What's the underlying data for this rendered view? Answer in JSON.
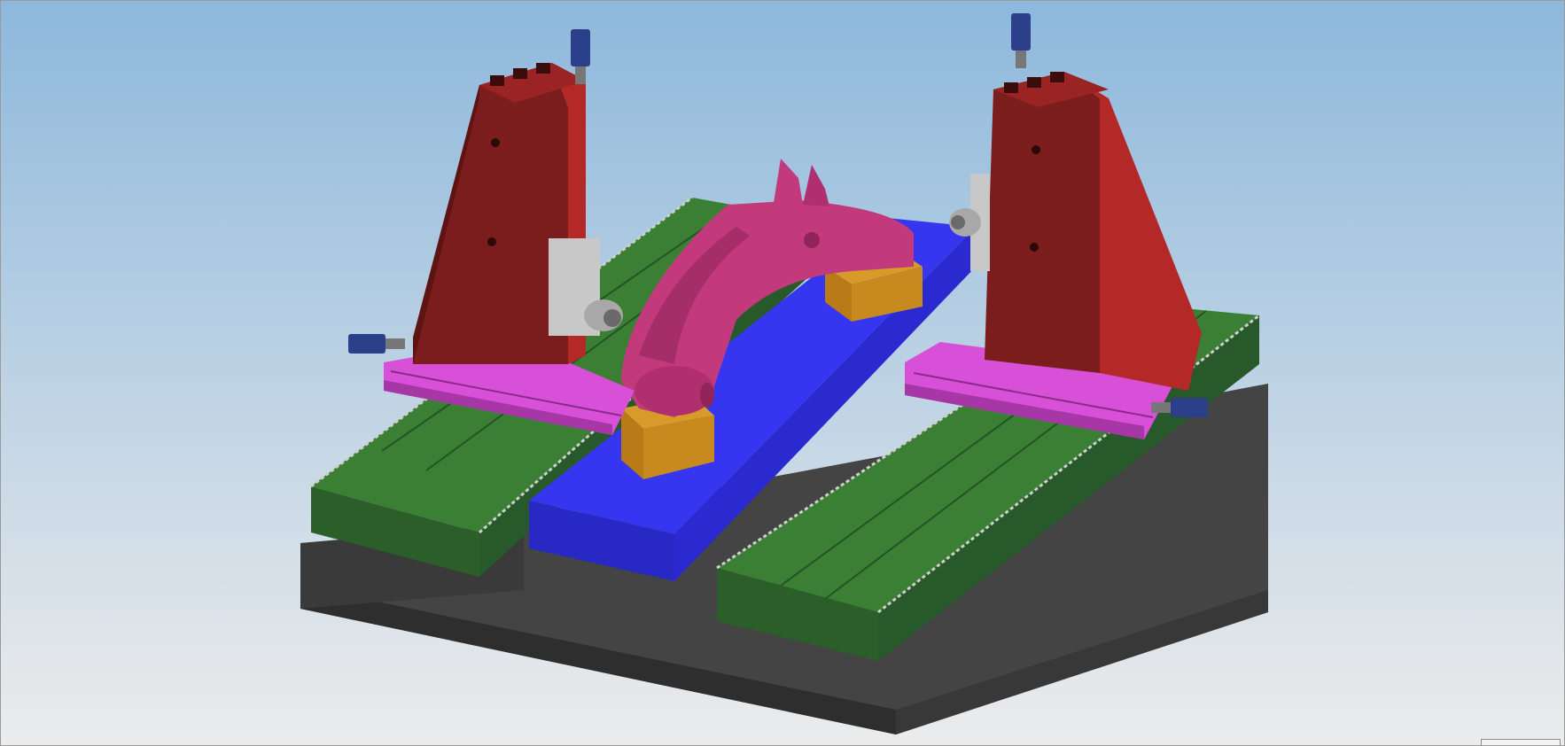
{
  "viewport": {
    "background_top": "#8db8dc",
    "background_bottom": "#ececec"
  },
  "colors": {
    "base_plate": "#444444",
    "base_plate_side": "#333333",
    "rail_bed": "#3b7f35",
    "rail_bed_dark": "#28592a",
    "worktable": "#3636f0",
    "worktable_side": "#2a2ad0",
    "column": "#7c1d1d",
    "column_side": "#b52828",
    "carriage": "#d84fd8",
    "workpiece_arm": "#c23a7c",
    "workpiece_arm_dark": "#8f2558",
    "support_block": "#c8891e",
    "support_block_side": "#9a6410",
    "motor": "#2c3f8a",
    "spindle": "#b8b8b8"
  },
  "model": {
    "parts": [
      "base-plate",
      "left-rail-bed",
      "right-rail-bed",
      "center-worktable",
      "left-column",
      "right-column",
      "left-carriage",
      "right-carriage",
      "workpiece-arm",
      "front-support-block",
      "rear-support-block",
      "left-vertical-motor",
      "right-vertical-motor",
      "left-horizontal-motor",
      "right-horizontal-motor",
      "left-spindle",
      "right-spindle"
    ]
  }
}
